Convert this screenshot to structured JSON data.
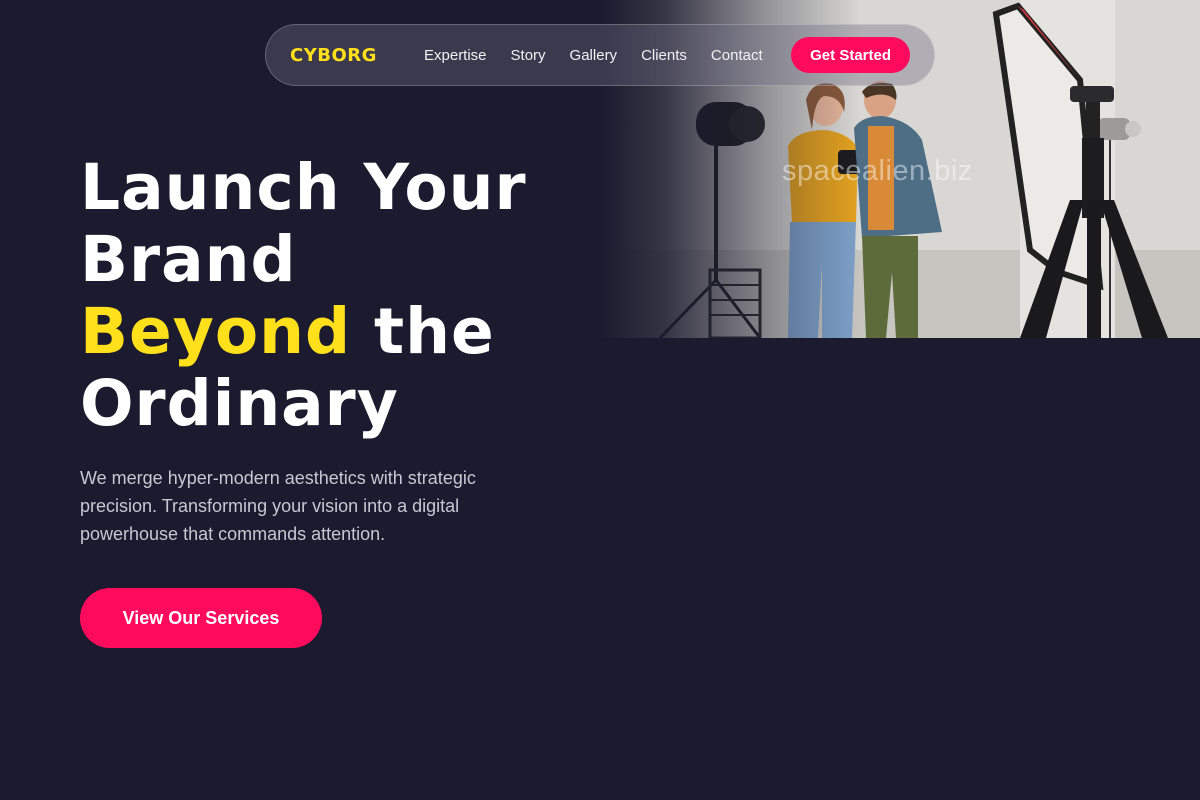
{
  "navbar": {
    "brand": "CYBORG",
    "links": [
      "Expertise",
      "Story",
      "Gallery",
      "Clients",
      "Contact"
    ],
    "cta_label": "Get Started"
  },
  "hero": {
    "headline": {
      "line1": "Launch Your",
      "line2": "Brand",
      "line3_accent": "Beyond",
      "line3_rest": " the",
      "line4": "Ordinary"
    },
    "subtext": "We merge hyper-modern aesthetics with strategic precision. Transforming your vision into a digital powerhouse that commands attention.",
    "cta_label": "View Our Services",
    "photo_watermark": "spacealien.biz"
  },
  "colors": {
    "background": "#1b1a2e",
    "accent_yellow": "#ffe01b",
    "accent_pink": "#ff0b5d",
    "body_text": "#c8c7d2"
  }
}
